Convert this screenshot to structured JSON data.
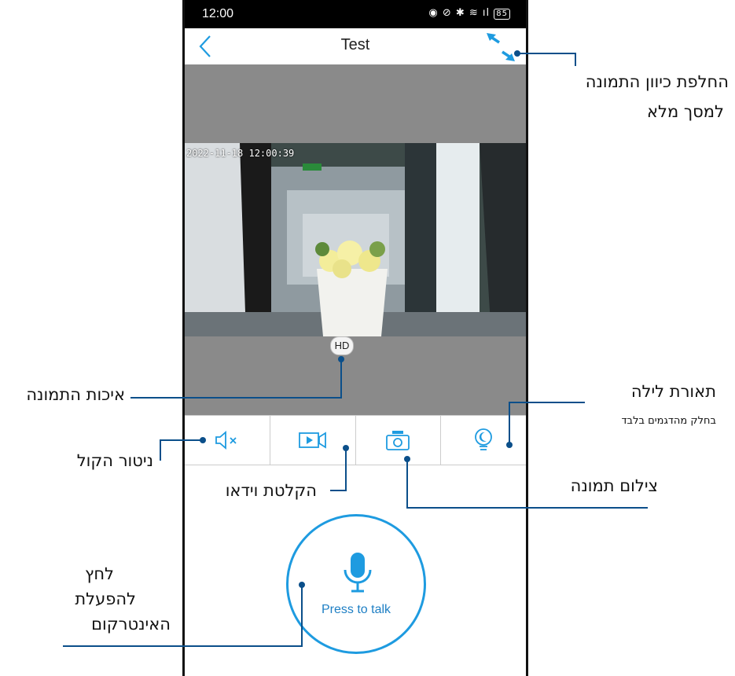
{
  "status_bar": {
    "time": "12:00",
    "icons": "◉ ⊘ ✱ ≋ ıl",
    "battery": "85"
  },
  "nav": {
    "title": "Test"
  },
  "video": {
    "timestamp": "2022-11-18 12:00:39",
    "quality_badge": "HD"
  },
  "toolbar": {
    "items": [
      {
        "name": "sound-monitor",
        "icon": "speaker-muted-icon"
      },
      {
        "name": "video-record",
        "icon": "video-camera-icon"
      },
      {
        "name": "snapshot",
        "icon": "camera-icon"
      },
      {
        "name": "night-light",
        "icon": "bulb-moon-icon"
      }
    ]
  },
  "talk": {
    "label": "Press to talk"
  },
  "annotations": {
    "rotate_fullscreen_line1": "החלפת כיוון התמונה",
    "rotate_fullscreen_line2": "למסך מלא",
    "image_quality": "איכות התמונה",
    "night_light_title": "תאורת לילה",
    "night_light_note": "בחלק מהדגמים בלבד",
    "sound_monitor": "ניטור הקול",
    "video_record": "הקלטת וידאו",
    "photo": "צילום תמונה",
    "press_line1": "לחץ",
    "press_line2": "להפעלת",
    "press_line3": "האינטרקום"
  },
  "colors": {
    "accent": "#1e9be0",
    "annotation_line": "#0b4f8a",
    "video_bg": "#8a8a8a"
  }
}
